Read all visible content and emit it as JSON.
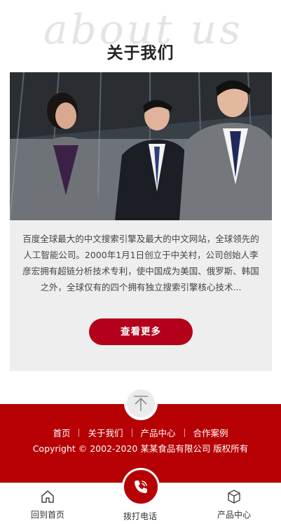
{
  "about": {
    "watermark": "about us",
    "title": "关于我们",
    "description": "百度全球最大的中文搜索引擎及最大的中文网站，全球领先的人工智能公司。2000年1月1日创立于中关村，公司创始人李彦宏拥有超链分析技术专利，使中国成为美国、俄罗斯、韩国之外，全球仅有的四个拥有独立搜索引擎核心技术...",
    "more_label": "查看更多"
  },
  "footer": {
    "nav": [
      {
        "label": "首页"
      },
      {
        "label": "关于我们"
      },
      {
        "label": "产品中心"
      },
      {
        "label": "合作案例"
      }
    ],
    "copyright": "Copyright © 2002-2020 某某食品有限公司 版权所有"
  },
  "tabbar": {
    "home": {
      "label": "回到首页",
      "icon": "home-icon"
    },
    "call": {
      "label": "拨打电话",
      "icon": "phone-icon"
    },
    "products": {
      "label": "产品中心",
      "icon": "box-icon"
    }
  },
  "colors": {
    "brand_red": "#b70003",
    "button_red": "#b4001b",
    "card_bg": "#eeeeee"
  }
}
